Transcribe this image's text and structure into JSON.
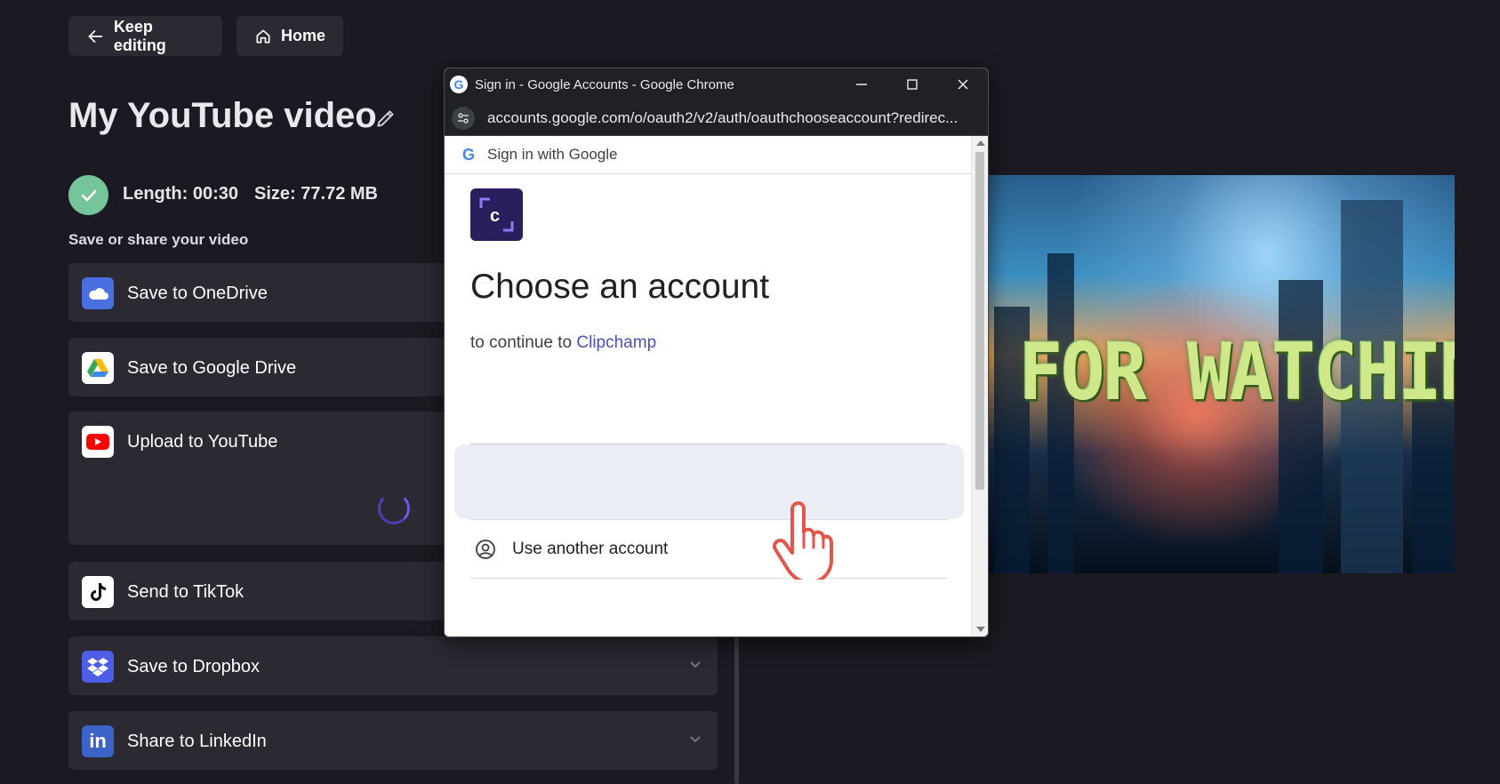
{
  "top_bar": {
    "keep_editing_label": "Keep editing",
    "home_label": "Home"
  },
  "video": {
    "title": "My YouTube video",
    "length_label": "Length: 00:30",
    "size_label": "Size: 77.72 MB"
  },
  "share": {
    "heading": "Save or share your video",
    "options": [
      {
        "label": "Save to OneDrive",
        "icon": "onedrive-icon",
        "color": "#4a6fe0"
      },
      {
        "label": "Save to Google Drive",
        "icon": "google-drive-icon",
        "color": "#ffffff"
      },
      {
        "label": "Upload to YouTube",
        "icon": "youtube-icon",
        "color": "#ffffff"
      },
      {
        "label": "Send to TikTok",
        "icon": "tiktok-icon",
        "color": "#ffffff"
      },
      {
        "label": "Save to Dropbox",
        "icon": "dropbox-icon",
        "color": "#4c5ee8"
      },
      {
        "label": "Share to LinkedIn",
        "icon": "linkedin-icon",
        "color": "#3b63c9"
      }
    ]
  },
  "preview": {
    "overlay_text": "FOR WATCHING"
  },
  "chrome_popup": {
    "window_title": "Sign in - Google Accounts - Google Chrome",
    "url": "accounts.google.com/o/oauth2/v2/auth/oauthchooseaccount?redirec...",
    "header_label": "Sign in with Google",
    "heading": "Choose an account",
    "continue_prefix": "to continue to",
    "continue_app": "Clipchamp",
    "use_another_account": "Use another account"
  },
  "colors": {
    "background": "#1b1a22",
    "card": "#2b2a33",
    "accent_link": "#4a4fb9",
    "success": "#74c69a"
  }
}
